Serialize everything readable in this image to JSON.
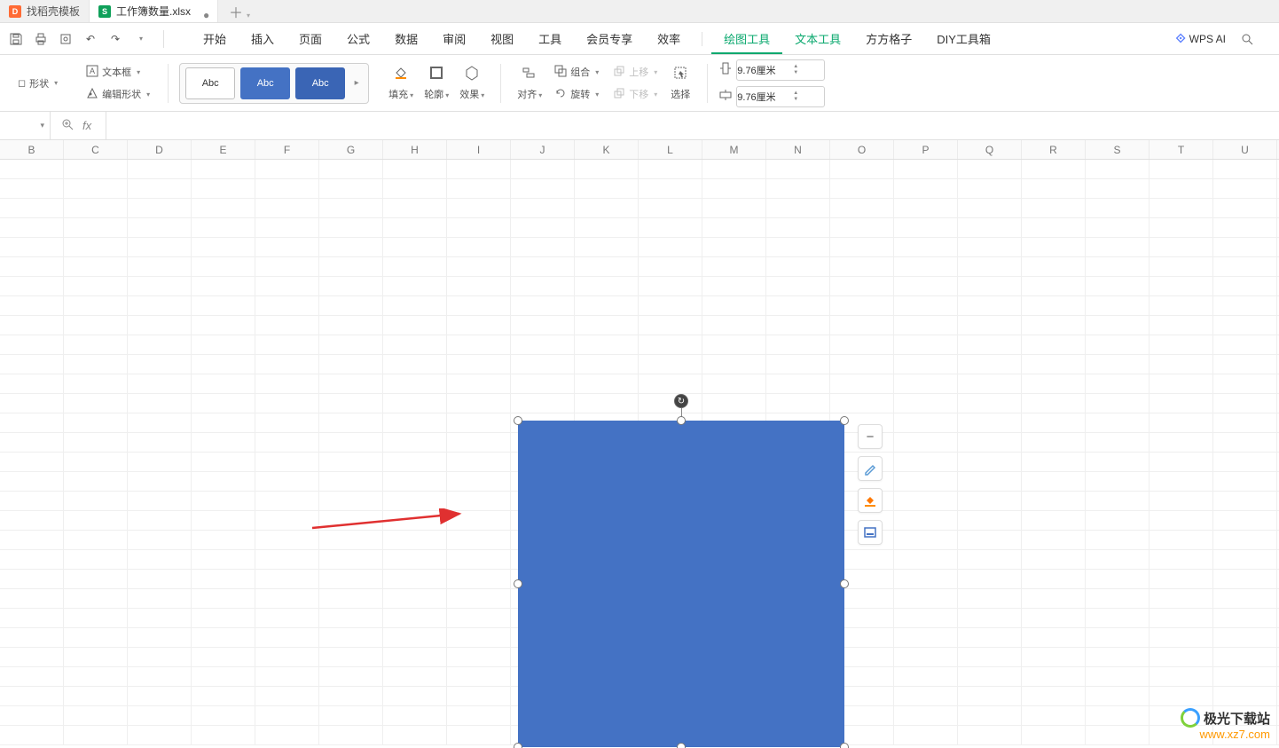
{
  "tabs": {
    "template": "找稻壳模板",
    "file": "工作簿数量.xlsx"
  },
  "menu": {
    "start": "开始",
    "insert": "插入",
    "page": "页面",
    "formula": "公式",
    "data": "数据",
    "review": "审阅",
    "view": "视图",
    "tools": "工具",
    "member": "会员专享",
    "efficiency": "效率",
    "drawing": "绘图工具",
    "text_tool": "文本工具",
    "square": "方方格子",
    "diy": "DIY工具箱",
    "wps_ai": "WPS AI"
  },
  "ribbon": {
    "shape": "形状",
    "textbox": "文本框",
    "edit_shape": "编辑形状",
    "style_abc": "Abc",
    "fill": "填充",
    "outline": "轮廓",
    "effect": "效果",
    "align": "对齐",
    "group": "组合",
    "rotate": "旋转",
    "move_up": "上移",
    "move_down": "下移",
    "select": "选择",
    "height_icon": "⬍",
    "width_icon": "⬌",
    "height_val": "9.76厘米",
    "width_val": "9.76厘米"
  },
  "columns": [
    "B",
    "C",
    "D",
    "E",
    "F",
    "G",
    "H",
    "I",
    "J",
    "K",
    "L",
    "M",
    "N",
    "O",
    "P",
    "Q",
    "R",
    "S",
    "T",
    "U"
  ],
  "float_tools": {
    "minus": "−",
    "pen": "✎",
    "bucket": "▰",
    "preset": "▭"
  },
  "watermark": {
    "name": "极光下载站",
    "url": "www.xz7.com"
  }
}
